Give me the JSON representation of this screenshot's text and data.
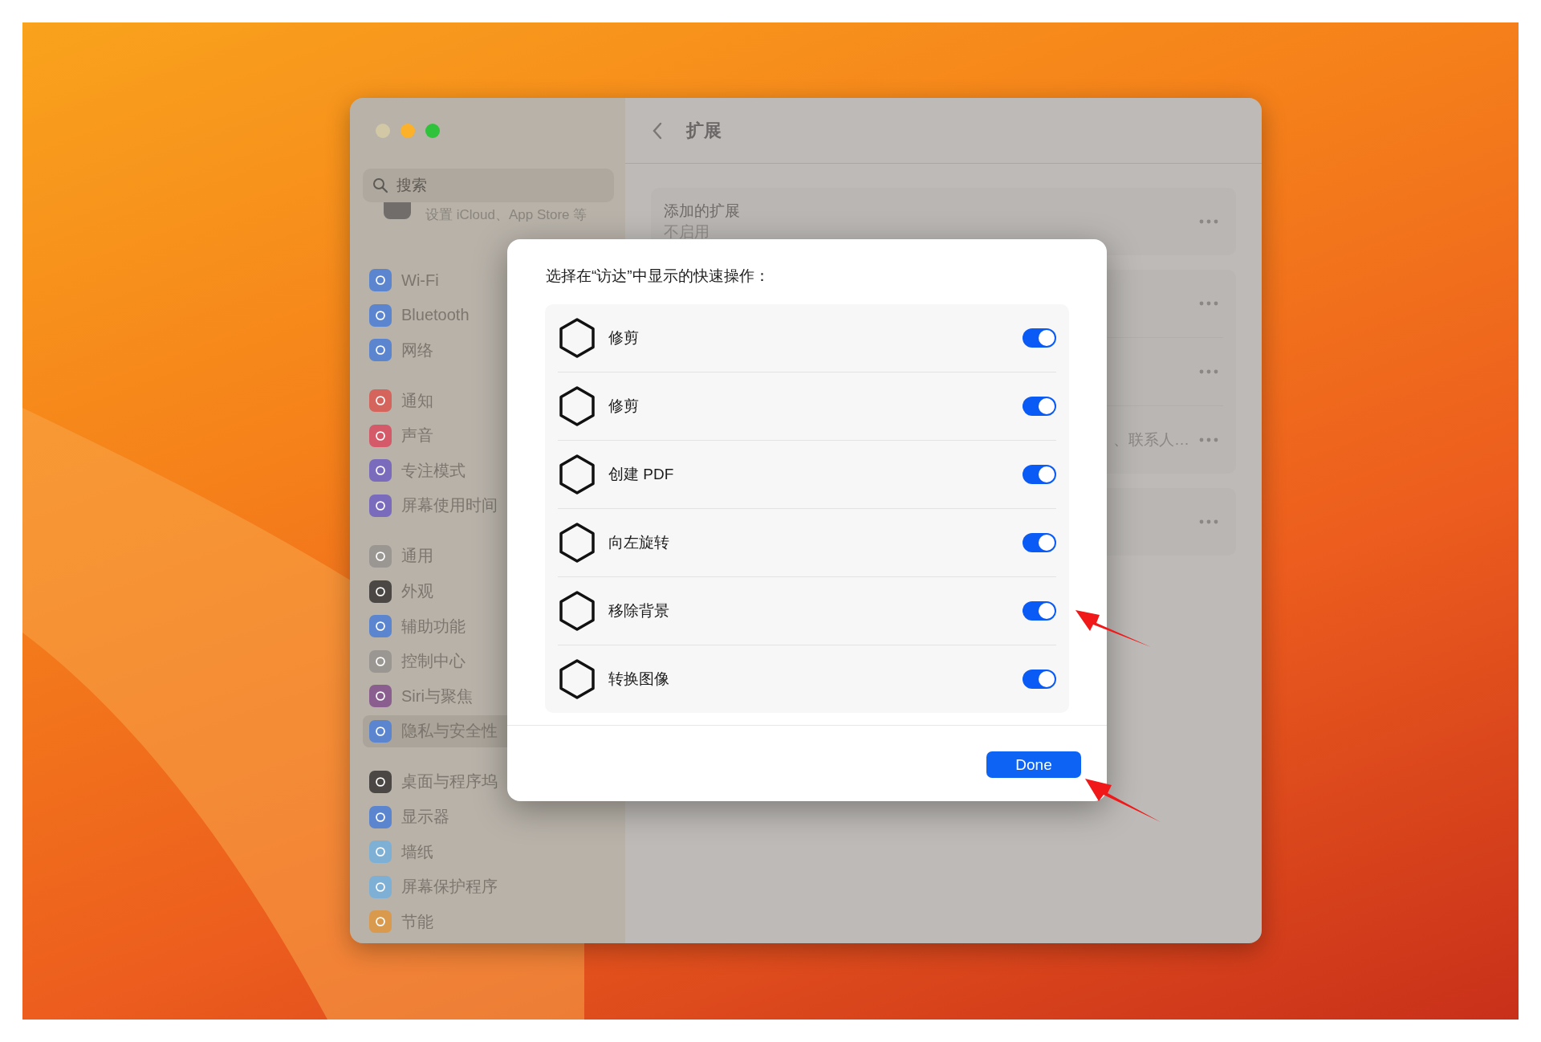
{
  "sidebar": {
    "search": {
      "placeholder": "搜索"
    },
    "account_hint": "设置 iCloud、App Store 等",
    "groups": [
      [
        {
          "label": "Wi-Fi",
          "color": "#5b86cf",
          "selected": false
        },
        {
          "label": "Bluetooth",
          "color": "#5b86cf",
          "selected": false
        },
        {
          "label": "网络",
          "color": "#5b86cf",
          "selected": false
        }
      ],
      [
        {
          "label": "通知",
          "color": "#d4645c",
          "selected": false
        },
        {
          "label": "声音",
          "color": "#d45a6a",
          "selected": false
        },
        {
          "label": "专注模式",
          "color": "#7a6bbd",
          "selected": false
        },
        {
          "label": "屏幕使用时间",
          "color": "#7a6bbd",
          "selected": false
        }
      ],
      [
        {
          "label": "通用",
          "color": "#9a9692",
          "selected": false
        },
        {
          "label": "外观",
          "color": "#4a4744",
          "selected": false
        },
        {
          "label": "辅助功能",
          "color": "#5b86cf",
          "selected": false
        },
        {
          "label": "控制中心",
          "color": "#9a9692",
          "selected": false
        },
        {
          "label": "Siri与聚焦",
          "color": "#8a5f8f",
          "selected": false
        },
        {
          "label": "隐私与安全性",
          "color": "#5b86cf",
          "selected": true
        }
      ],
      [
        {
          "label": "桌面与程序坞",
          "color": "#4a4744",
          "selected": false
        },
        {
          "label": "显示器",
          "color": "#5b86cf",
          "selected": false
        },
        {
          "label": "墙纸",
          "color": "#7eb0d6",
          "selected": false
        },
        {
          "label": "屏幕保护程序",
          "color": "#7eb0d6",
          "selected": false
        },
        {
          "label": "节能",
          "color": "#d99a4e",
          "selected": false
        }
      ]
    ]
  },
  "main": {
    "title": "扩展",
    "sections": [
      {
        "rows": [
          {
            "title": "添加的扩展",
            "subtitle": "不启用",
            "more": true
          }
        ]
      },
      {
        "rows": [
          {
            "more": true
          },
          {
            "more": true
          },
          {
            "subtitle": "、联系人…",
            "more": true
          }
        ]
      },
      {
        "rows": [
          {
            "more": true
          }
        ]
      }
    ]
  },
  "dialog": {
    "prompt": "选择在“访达”中显示的快速操作：",
    "actions": [
      {
        "label": "修剪",
        "on": true
      },
      {
        "label": "修剪",
        "on": true
      },
      {
        "label": "创建 PDF",
        "on": true
      },
      {
        "label": "向左旋转",
        "on": true
      },
      {
        "label": "移除背景",
        "on": true
      },
      {
        "label": "转换图像",
        "on": true
      }
    ],
    "done": "Done"
  }
}
